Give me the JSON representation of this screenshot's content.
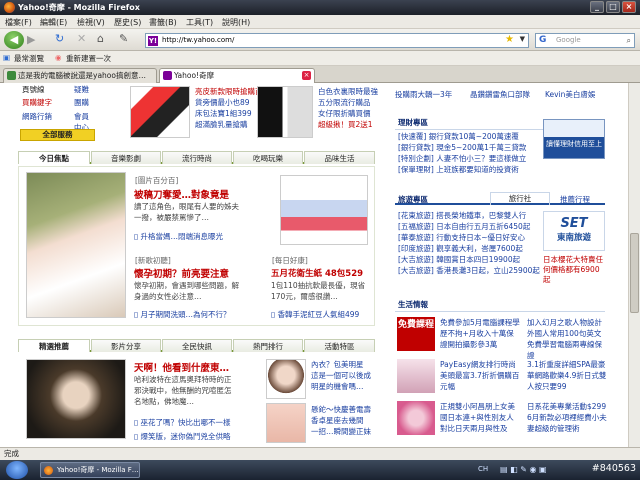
{
  "window": {
    "title": "Yahoo!奇摩 - Mozilla Firefox",
    "min": "_",
    "max": "□",
    "close": "×"
  },
  "menu": [
    "檔案(F)",
    "編輯(E)",
    "檢視(V)",
    "歷史(S)",
    "書籤(B)",
    "工具(T)",
    "說明(H)"
  ],
  "nav": {
    "url": "http://tw.yahoo.com/",
    "search_placeholder": "Google",
    "url_icon": "Y!"
  },
  "bookmarks": [
    "最常瀏覽",
    "重新建置一次"
  ],
  "tabs": [
    {
      "label": "這是我的電腦被說還是yahoo搞創意…"
    },
    {
      "label": "Yahoo!奇摩"
    }
  ],
  "top_links": {
    "left": [
      [
        "頁號線",
        "疑難"
      ],
      [
        "買購鍵字",
        "團購"
      ],
      [
        "網路行銷",
        "會員中心"
      ]
    ],
    "all_services": "全部服務",
    "ad1": [
      "亮皮新款限時搶購百",
      "貨旁價最小也89",
      "床包法寶1組399",
      "超滿臉乳量搶購"
    ],
    "ad2": [
      "白色衣裏限時最強",
      "五分限流行購品",
      "女仔限折購買價",
      "超級揪！買2送1"
    ],
    "top_right": [
      "投購雨大轎一3年",
      "晶鑽鑽雷魚口部隊",
      "Kevin美白膚娛"
    ]
  },
  "sections": {
    "main_tabs": [
      "今日焦點",
      "音樂影劇",
      "流行時尚",
      "吃喝玩樂",
      "品味生活"
    ],
    "story1": {
      "tag": "[圖片百分百]",
      "title": "被稿刀奪愛…對象竟是",
      "body": [
        "讀了這角色，眼尾有人要的姊夫",
        "一撥，被嚴禁罵慘了…"
      ],
      "link": "升格當媽…悶端消息曝光"
    },
    "story2": {
      "tag": "[新歌初聽]",
      "title": "懷孕初期？前亮要注意",
      "body": [
        "懷孕初期，會遇到哪些問題，解",
        "身過的女性必注意…"
      ],
      "link": "月子期間洗頭…為何不行？"
    },
    "product": {
      "tag": "[每日好康]",
      "title": "五月花衛生紙 48包529",
      "body": [
        "1包110抽抗軟最長優，現省",
        "170元，爾感很讚…"
      ],
      "link": "香韓手泥紅豆人氣組499"
    },
    "second_tabs": [
      "精選推薦",
      "影片分享",
      "全民快訊",
      "熱門排行",
      "活動特區"
    ],
    "story3": {
      "title": "天啊！他看到什麼東…",
      "body": [
        "哈利波特在這馬奧拜特時的正",
        "邪決戰中，他無酬的咒喧匿怎",
        "名地點，佛地魔…"
      ],
      "links": [
        "巫花了嗎？快比出哪不一樣",
        "爆笑版，迷你偽鬥兇全供略"
      ]
    },
    "story4": {
      "lines": [
        "內衣？包美明星",
        "這是一個可以後成",
        "明星的機會嗎…"
      ],
      "lines2": [
        "懸鉈～快慶善電壽",
        "香卓星座去幾間",
        "一招…瞬間變正妹"
      ]
    }
  },
  "right": {
    "finance": {
      "title": "理財專區",
      "links": [
        "[快速覆] 銀行貸款10萬~200萬速覆",
        "[銀行貸款] 現金5~200萬1千萬三貸款",
        "[特別企劃] 人妻不怕小三？要這樣做立",
        "[保單理財] 上班族都要知道的投資術"
      ],
      "ad": "讀懂理財信用至上"
    },
    "travel": {
      "tabs": [
        "旅遊專區",
        "旅行社",
        "推薦行程"
      ],
      "links": [
        "[花東旅遊] 搭長榮地鐵車，巴黎雙人行",
        "[五福旅遊] 日本自由行五月五折6450起",
        "[華泰旅遊] 行動支持日本~優日好安心",
        "[印度旅遊] 觀享義大利，峇厘7600起",
        "[大吉旅遊] 韓國賞日本四日19900起",
        "[大吉旅遊] 香港長灘3日起，立山25900起"
      ],
      "logo": "東南旅遊",
      "ad": "日本櫻花大特賣任何價格都有6900起"
    },
    "life": {
      "title": "生活情報",
      "items": [
        "免費參加5月電腦課程學歷不拘+月收入十萬保證開拍攝影參3萬",
        "PayEasy網友排行時尚美頭最富3.7折折價購百元幅",
        "正規雙小阿昌朋上女美國日本連+與性別友人對比日天兩月與性及",
        "加入幻月之歌人物設計外國人常用100句英文免費學習電腦兩專線保證",
        "3.1折重度詳細SPA最豪華網路歡樂4.9折日式雙人按只要99",
        "日系花美專業活動$299 6月新款必項裡經費小夫妻超級的管理術"
      ],
      "ad": "免費課程"
    }
  },
  "status": "完成",
  "taskbar": {
    "item": "Yahoo!奇摩 - Mozilla F…",
    "tray": "CH",
    "clock": "#840563"
  }
}
